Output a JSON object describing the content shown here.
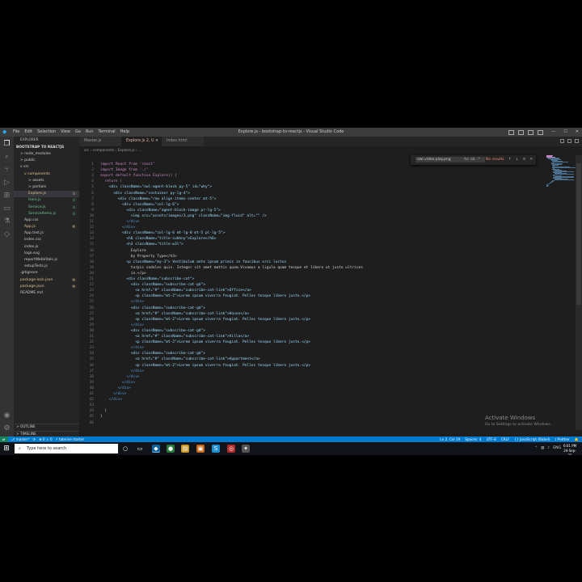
{
  "window": {
    "title": "Explore.js - bootstrap-to-reactjs - Visual Studio Code",
    "menu": [
      "File",
      "Edit",
      "Selection",
      "View",
      "Go",
      "Run",
      "Terminal",
      "Help"
    ],
    "controls": [
      "—",
      "☐",
      "✕"
    ]
  },
  "sidebar": {
    "header": "EXPLORER",
    "project": "BOOTSTRAP TO REACTJS",
    "tree": [
      {
        "label": "> node_modules",
        "indent": 0,
        "color": "#cccccc",
        "badge": ""
      },
      {
        "label": "> public",
        "indent": 0,
        "color": "#cccccc",
        "badge": ""
      },
      {
        "label": "v src",
        "indent": 0,
        "color": "#cccccc",
        "badge": ""
      },
      {
        "label": "v components",
        "indent": 1,
        "color": "#e2c08d",
        "badge": ""
      },
      {
        "label": "> assets",
        "indent": 2,
        "color": "#cccccc",
        "badge": ""
      },
      {
        "label": "> partials",
        "indent": 2,
        "color": "#cccccc",
        "badge": ""
      },
      {
        "label": "Explore.js",
        "indent": 2,
        "color": "#e2c08d",
        "badge": "U",
        "active": true
      },
      {
        "label": "Hero.js",
        "indent": 2,
        "color": "#73c991",
        "badge": "U"
      },
      {
        "label": "Service.js",
        "indent": 2,
        "color": "#73c991",
        "badge": "U"
      },
      {
        "label": "ServiceItems.js",
        "indent": 2,
        "color": "#73c991",
        "badge": "U"
      },
      {
        "label": "App.css",
        "indent": 1,
        "color": "#cccccc",
        "badge": ""
      },
      {
        "label": "App.js",
        "indent": 1,
        "color": "#e2c08d",
        "badge": "M"
      },
      {
        "label": "App.test.js",
        "indent": 1,
        "color": "#cccccc",
        "badge": ""
      },
      {
        "label": "index.css",
        "indent": 1,
        "color": "#cccccc",
        "badge": ""
      },
      {
        "label": "index.js",
        "indent": 1,
        "color": "#cccccc",
        "badge": ""
      },
      {
        "label": "logo.svg",
        "indent": 1,
        "color": "#cccccc",
        "badge": ""
      },
      {
        "label": "reportWebVitals.js",
        "indent": 1,
        "color": "#cccccc",
        "badge": ""
      },
      {
        "label": "setupTests.js",
        "indent": 1,
        "color": "#cccccc",
        "badge": ""
      },
      {
        "label": ".gitignore",
        "indent": 0,
        "color": "#cccccc",
        "badge": ""
      },
      {
        "label": "package-lock.json",
        "indent": 0,
        "color": "#e2c08d",
        "badge": "M"
      },
      {
        "label": "package.json",
        "indent": 0,
        "color": "#e2c08d",
        "badge": "M"
      },
      {
        "label": "README.md",
        "indent": 0,
        "color": "#cccccc",
        "badge": ""
      }
    ],
    "outline": "> OUTLINE",
    "timeline": "> TIMELINE"
  },
  "tabs": [
    {
      "label": "Master.js",
      "active": false,
      "close": ""
    },
    {
      "label": "Explore.js  2, U",
      "active": true,
      "close": "✕"
    },
    {
      "label": "index.html",
      "active": false,
      "close": ""
    }
  ],
  "breadcrumb": "src › components › Explore.js › ...",
  "find": {
    "query": "owl.video.play.png",
    "options": [
      "Aa",
      "ab",
      ".*"
    ],
    "result": "No results",
    "buttons": [
      "↑",
      "↓",
      "≡",
      "✕"
    ]
  },
  "code": [
    {
      "n": "1",
      "i": 0,
      "t": "import React from 'react'"
    },
    {
      "n": "2",
      "i": 0,
      "t": "import Image from './'"
    },
    {
      "n": "3",
      "i": 0,
      "t": "export default function Explore() {"
    },
    {
      "n": "4",
      "i": 1,
      "t": "return ("
    },
    {
      "n": "5",
      "i": 2,
      "t": "<div className=\"owl-agent-block py-5\" id=\"why\">"
    },
    {
      "n": "6",
      "i": 3,
      "t": "<div className=\"container py-lg-4\">"
    },
    {
      "n": "7",
      "i": 4,
      "t": "<div className=\"row align-items-center mt-5\">"
    },
    {
      "n": "8",
      "i": 5,
      "t": "<div className=\"col-lg-6\">"
    },
    {
      "n": "9",
      "i": 6,
      "t": "<div className=\"agent-block-image pr-lg-5\">"
    },
    {
      "n": "10",
      "i": 7,
      "t": "<img src=\"assets/images/3.png\" className=\"img-fluid\" alt=\"\" />"
    },
    {
      "n": "11",
      "i": 6,
      "t": "</div>"
    },
    {
      "n": "12",
      "i": 5,
      "t": "</div>"
    },
    {
      "n": "13",
      "i": 5,
      "t": "<div className=\"col-lg-6 mt-lg-0 mt-5 pl-lg-5\">"
    },
    {
      "n": "14",
      "i": 6,
      "t": "<h6 className=\"title-subhny\">Explore</h6>"
    },
    {
      "n": "15",
      "i": 6,
      "t": "<h3 className=\"title-w3l\">"
    },
    {
      "n": "16",
      "i": 7,
      "t": "Explore"
    },
    {
      "n": "17",
      "i": 7,
      "t": "by Property Type</h3>"
    },
    {
      "n": "18",
      "i": 6,
      "t": "<p className=\"my-3\"> Vestibulum ante ipsum primis in faucibus orci luctus"
    },
    {
      "n": "19",
      "i": 7,
      "t": "turpis sodales quis. Integer sit amet mattis quam.Vivamus a ligula quam tesque et libero ut justo ultrices"
    },
    {
      "n": "20",
      "i": 7,
      "t": "in.</p>"
    },
    {
      "n": "21",
      "i": 6,
      "t": "<div className=\"subscribe-cat\">"
    },
    {
      "n": "22",
      "i": 7,
      "t": "<div className=\"subscribe-cat-gd\">"
    },
    {
      "n": "23",
      "i": 8,
      "t": "<a href=\"#\" className=\"subscribe-cat-link\">Office</a>"
    },
    {
      "n": "24",
      "i": 8,
      "t": "<p className=\"mt-2\">Lorem ipsum viverra feugiat. Pelles tesque libero justo.</p>"
    },
    {
      "n": "25",
      "i": 7,
      "t": "</div>"
    },
    {
      "n": "26",
      "i": 7,
      "t": "<div className=\"subscribe-cat-gd\">"
    },
    {
      "n": "27",
      "i": 8,
      "t": "<a href=\"#\" className=\"subscribe-cat-link\">House</a>"
    },
    {
      "n": "28",
      "i": 8,
      "t": "<p className=\"mt-2\">Lorem ipsum viverra feugiat. Pelles tesque libero justo.</p>"
    },
    {
      "n": "29",
      "i": 7,
      "t": "</div>"
    },
    {
      "n": "30",
      "i": 7,
      "t": "<div className=\"subscribe-cat-gd\">"
    },
    {
      "n": "31",
      "i": 8,
      "t": "<a href=\"#\" className=\"subscribe-cat-link\">Villa</a>"
    },
    {
      "n": "32",
      "i": 8,
      "t": "<p className=\"mt-2\">Lorem ipsum viverra feugiat. Pelles tesque libero justo.</p>"
    },
    {
      "n": "33",
      "i": 7,
      "t": "</div>"
    },
    {
      "n": "34",
      "i": 7,
      "t": "<div className=\"subscribe-cat-gd\">"
    },
    {
      "n": "35",
      "i": 8,
      "t": "<a href=\"#\" className=\"subscribe-cat-link\">Appartment</a>"
    },
    {
      "n": "36",
      "i": 8,
      "t": "<p className=\"mt-2\">Lorem ipsum viverra feugiat. Pelles tesque libero justo.</p>"
    },
    {
      "n": "37",
      "i": 7,
      "t": "</div>"
    },
    {
      "n": "38",
      "i": 6,
      "t": "</div>"
    },
    {
      "n": "39",
      "i": 5,
      "t": "</div>"
    },
    {
      "n": "40",
      "i": 4,
      "t": "</div>"
    },
    {
      "n": "41",
      "i": 3,
      "t": "</div>"
    },
    {
      "n": "42",
      "i": 2,
      "t": "</div>"
    },
    {
      "n": "43",
      "i": 0,
      "t": ""
    },
    {
      "n": "44",
      "i": 1,
      "t": ")"
    },
    {
      "n": "45",
      "i": 0,
      "t": "}"
    },
    {
      "n": "46",
      "i": 0,
      "t": ""
    }
  ],
  "colors": {
    "keyword": "#c586c0",
    "tag": "#569cd6",
    "attr": "#9cdcfe",
    "string": "#ce9178",
    "text": "#d4d4d4",
    "func": "#dcdcaa"
  },
  "watermark": {
    "line1": "Activate Windows",
    "line2": "Go to Settings to activate Windows."
  },
  "statusbar": {
    "branch": "⎇ master*",
    "sync": "⟳",
    "errors": "⊗ 0 ⚠ 0",
    "extra": "⚡ tabnine starter",
    "right": [
      "Ln 2, Col 19",
      "Spaces: 4",
      "UTF-8",
      "CRLF",
      "{} JavaScript (Babel)",
      "⟟ Prettier",
      "🔔"
    ]
  },
  "taskbar": {
    "search_placeholder": "Type here to search",
    "time": "6:01 PM",
    "date": "24-Sep-22",
    "lang": "ENG"
  }
}
